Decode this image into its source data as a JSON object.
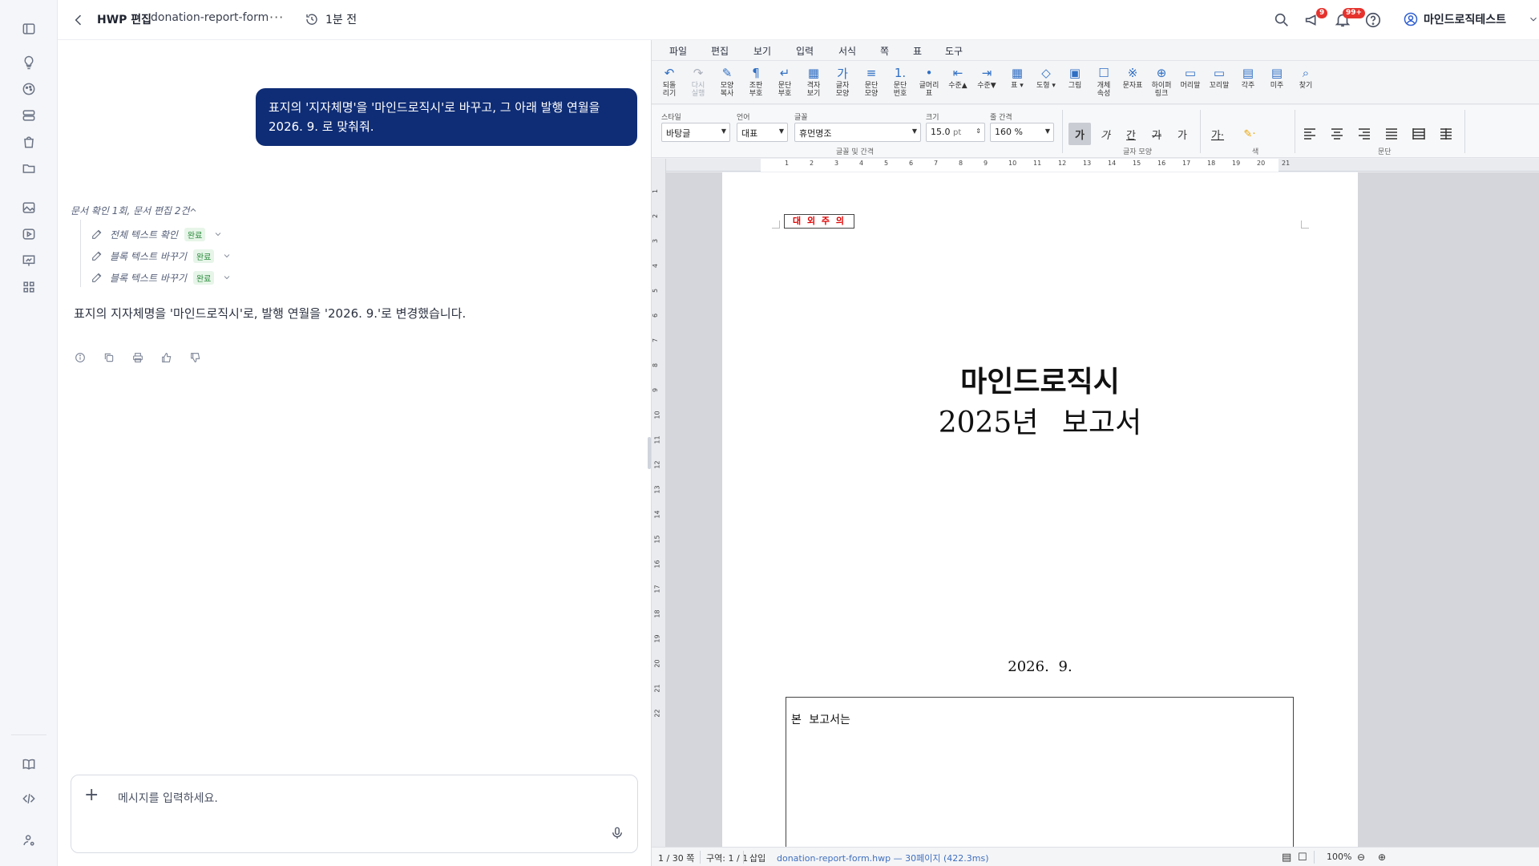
{
  "topbar": {
    "title": "HWP 편집",
    "file": "donation-report-form",
    "more": "···",
    "history": "1분 전",
    "announce_badge": "9",
    "notif_badge": "99+",
    "user": "마인드로직테스트"
  },
  "chat": {
    "user_message": "표지의 '지자체명'을 '마인드로직시'로 바꾸고, 그 아래 발행 연월을 2026. 9. 로 맞춰줘.",
    "steps_header": "문서 확인 1회, 문서 편집 2건",
    "steps": [
      {
        "label": "전체 텍스트 확인",
        "status": "완료"
      },
      {
        "label": "블록 텍스트 바꾸기",
        "status": "완료"
      },
      {
        "label": "블록 텍스트 바꾸기",
        "status": "완료"
      }
    ],
    "answer": "표지의 지자체명을 '마인드로직시'로, 발행 연월을 '2026. 9.'로 변경했습니다.",
    "composer_plus": "+",
    "composer_placeholder": "메시지를 입력하세요."
  },
  "editor": {
    "menus": [
      "파일",
      "편집",
      "보기",
      "입력",
      "서식",
      "쪽",
      "표",
      "도구"
    ],
    "toolbar": [
      {
        "icon": "↶",
        "label": "되돌\n리기",
        "enabled": true
      },
      {
        "icon": "↷",
        "label": "다시\n실행",
        "enabled": false
      },
      {
        "icon": "✎",
        "label": "모양\n복사",
        "enabled": true
      },
      {
        "icon": "¶",
        "label": "조판\n부호",
        "enabled": true
      },
      {
        "icon": "↵",
        "label": "문단\n부호",
        "enabled": true
      },
      {
        "icon": "▦",
        "label": "격자\n보기",
        "enabled": true
      },
      {
        "icon": "가",
        "label": "글자\n모양",
        "enabled": true
      },
      {
        "icon": "≡",
        "label": "문단\n모양",
        "enabled": true
      },
      {
        "icon": "1.",
        "label": "문단\n번호",
        "enabled": true
      },
      {
        "icon": "•",
        "label": "글머리\n표",
        "enabled": true
      },
      {
        "icon": "⇤",
        "label": "수준▲",
        "enabled": true
      },
      {
        "icon": "⇥",
        "label": "수준▼",
        "enabled": true
      },
      {
        "icon": "▦",
        "label": "표 ▾",
        "enabled": true
      },
      {
        "icon": "◇",
        "label": "도형 ▾",
        "enabled": true
      },
      {
        "icon": "▣",
        "label": "그림",
        "enabled": true
      },
      {
        "icon": "☐",
        "label": "개체\n속성",
        "enabled": true
      },
      {
        "icon": "※",
        "label": "문자표",
        "enabled": true
      },
      {
        "icon": "⊕",
        "label": "하이퍼\n링크",
        "enabled": true
      },
      {
        "icon": "▭",
        "label": "머리말",
        "enabled": true
      },
      {
        "icon": "▭",
        "label": "꼬리말",
        "enabled": true
      },
      {
        "icon": "▤",
        "label": "각주",
        "enabled": true
      },
      {
        "icon": "▤",
        "label": "미주",
        "enabled": true
      },
      {
        "icon": "⌕",
        "label": "찾기",
        "enabled": true
      }
    ],
    "format": {
      "style_label": "스타일",
      "style_value": "바탕글",
      "lang_label": "언어",
      "lang_value": "대표",
      "font_label": "글꼴",
      "font_value": "휴먼명조",
      "size_label": "크기",
      "size_value": "15.0",
      "size_unit": "pt",
      "spacing_label": "줄 간격",
      "spacing_value": "160 %",
      "group_font": "글꼴 및 간격",
      "group_shape": "글자 모양",
      "group_color": "색",
      "group_para": "문단",
      "char_buttons": [
        "가",
        "가",
        "간",
        "가",
        "가"
      ]
    },
    "ruler_h": [
      "1",
      "2",
      "3",
      "4",
      "5",
      "6",
      "7",
      "8",
      "9",
      "10",
      "11",
      "12",
      "13",
      "14",
      "15",
      "16",
      "17",
      "18",
      "19",
      "20",
      "21"
    ],
    "ruler_v": [
      "1",
      "2",
      "3",
      "4",
      "5",
      "6",
      "7",
      "8",
      "9",
      "10",
      "11",
      "12",
      "13",
      "14",
      "15",
      "16",
      "17",
      "18",
      "19",
      "20",
      "21",
      "22"
    ],
    "document": {
      "stamp": "대 외 주 의",
      "title_line1": "마인드로직시",
      "title_line2": "2025년 보고서",
      "date": "2026. 9.",
      "box_text": "본 보고서는"
    },
    "status": {
      "page": "1 / 30 쪽",
      "section": "구역: 1 / 1",
      "mode": "삽입",
      "file_info": "donation-report-form.hwp — 30페이지 (422.3ms)",
      "zoom": "100%"
    }
  }
}
